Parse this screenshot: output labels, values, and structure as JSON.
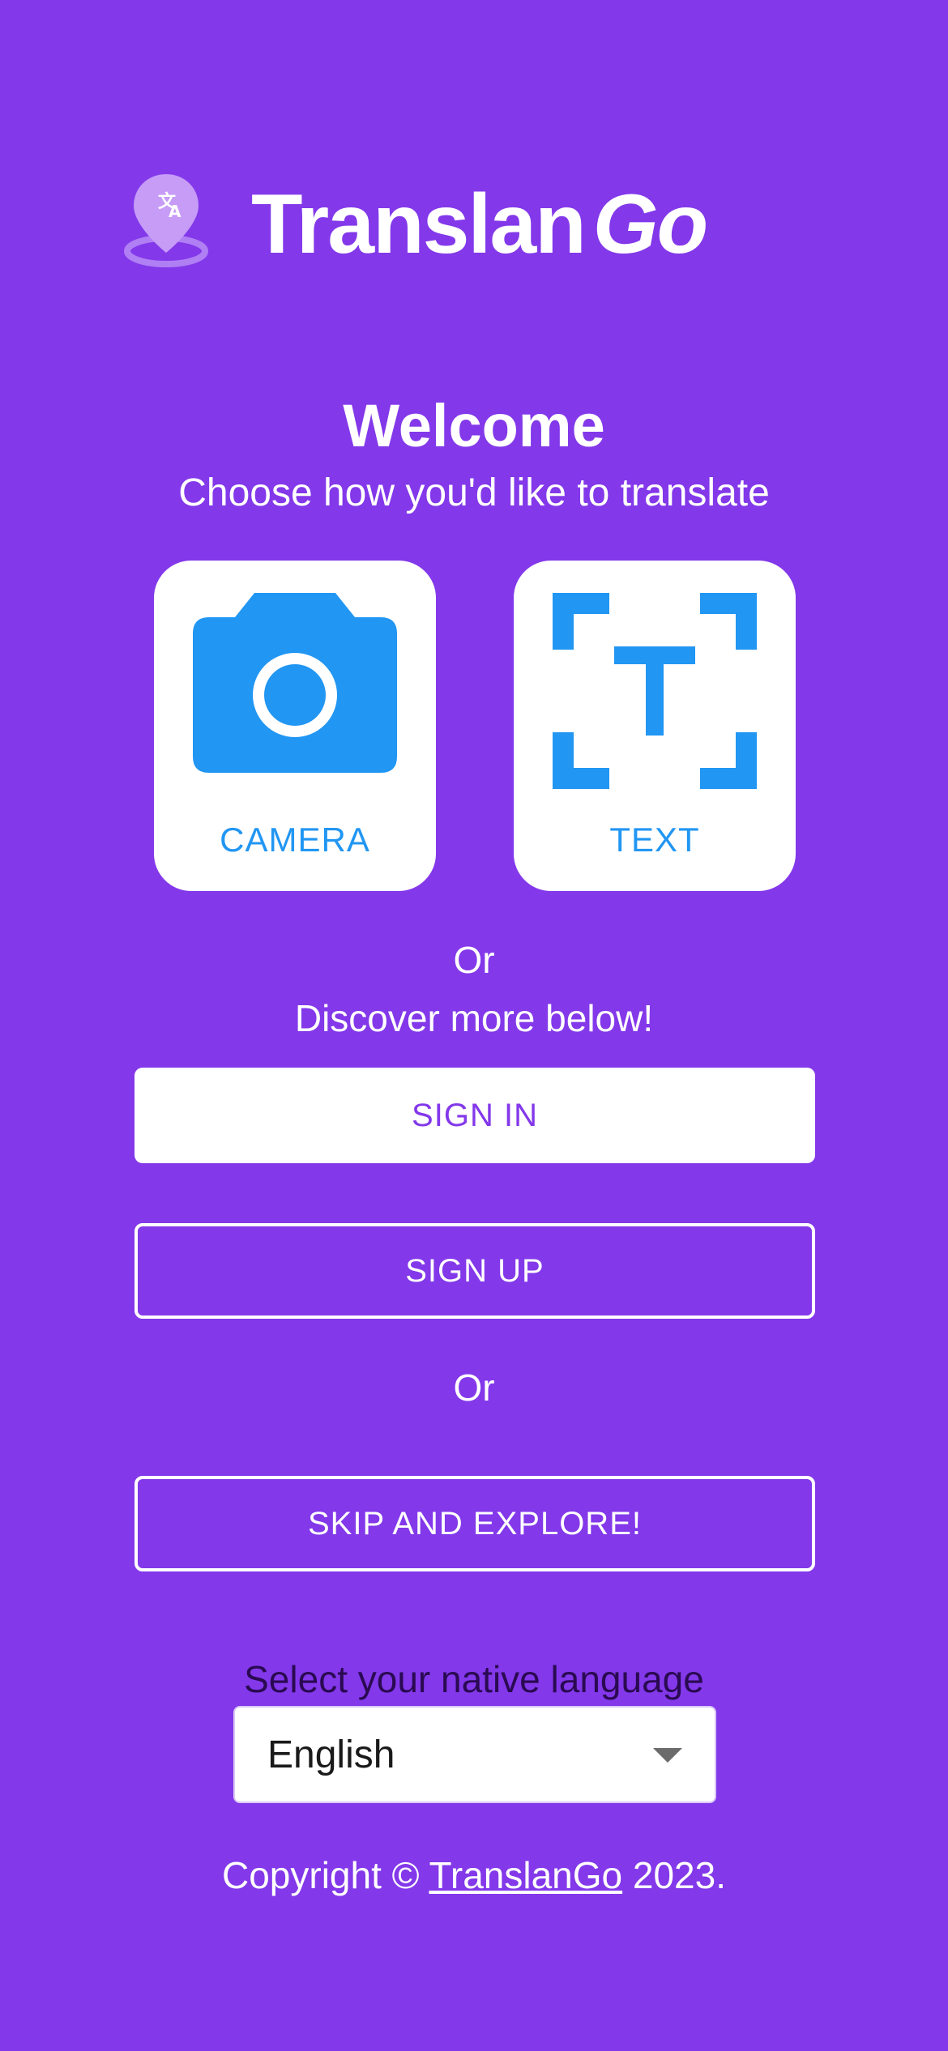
{
  "app": {
    "name_part1": "Translan",
    "name_part2": "Go"
  },
  "welcome": {
    "title": "Welcome",
    "subtitle": "Choose how you'd like to translate"
  },
  "modes": [
    {
      "label": "CAMERA",
      "icon": "camera-icon"
    },
    {
      "label": "TEXT",
      "icon": "text-scan-icon"
    }
  ],
  "divider": {
    "or": "Or",
    "discover": "Discover more below!"
  },
  "buttons": {
    "sign_in": "SIGN IN",
    "sign_up": "SIGN UP",
    "or": "Or",
    "skip": "SKIP AND EXPLORE!"
  },
  "language": {
    "label": "Select your native language",
    "selected": "English"
  },
  "footer": {
    "prefix": "Copyright © ",
    "link": "TranslanGo",
    "suffix": " 2023."
  },
  "colors": {
    "background": "#8338EA",
    "accent_blue": "#2196F3",
    "white": "#FFFFFF"
  }
}
